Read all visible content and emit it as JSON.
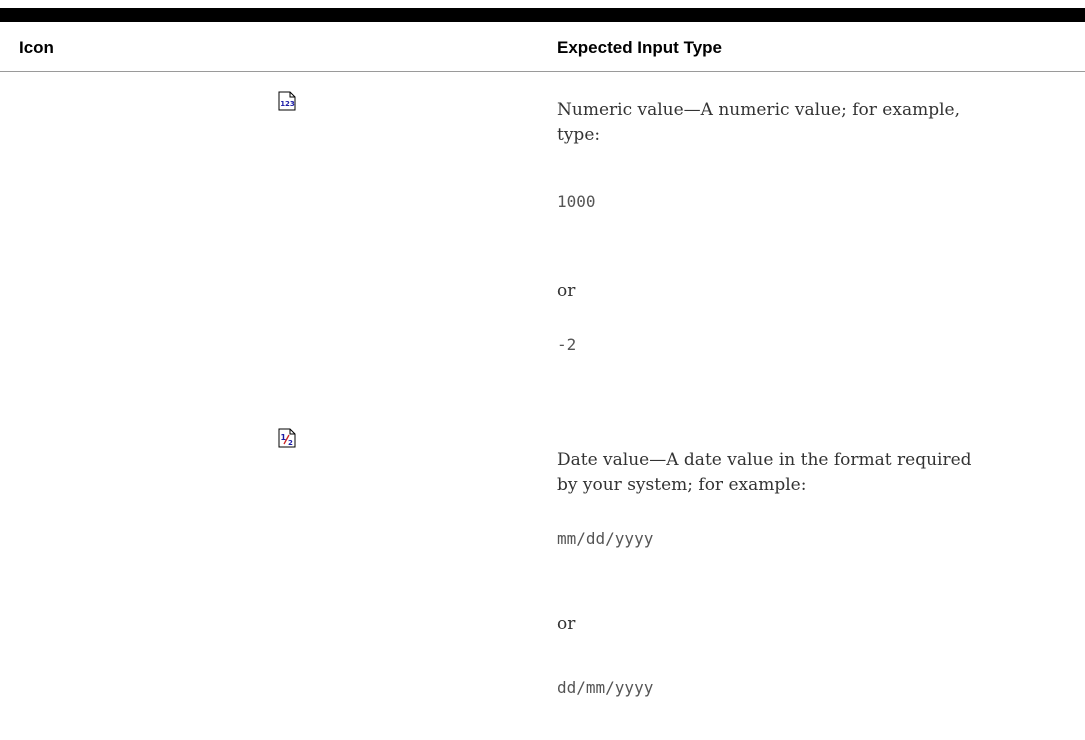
{
  "table": {
    "headers": {
      "icon": "Icon",
      "expected_input_type": "Expected Input Type"
    },
    "rows": [
      {
        "icon": "numeric-value-icon",
        "icon_text": "123",
        "description": "Numeric value—A numeric value; for example, type:",
        "example_1": "1000",
        "separator": "or",
        "example_2": "-2"
      },
      {
        "icon": "date-value-icon",
        "icon_text": "1/2",
        "description": "Date value—A date value in the format required by your system; for example:",
        "example_1": "mm/dd/yyyy",
        "separator": "or",
        "example_2": "dd/mm/yyyy"
      }
    ]
  },
  "colors": {
    "header_rule": "#000000",
    "icon_blue": "#1a1aa6",
    "icon_red": "#cc2222"
  }
}
